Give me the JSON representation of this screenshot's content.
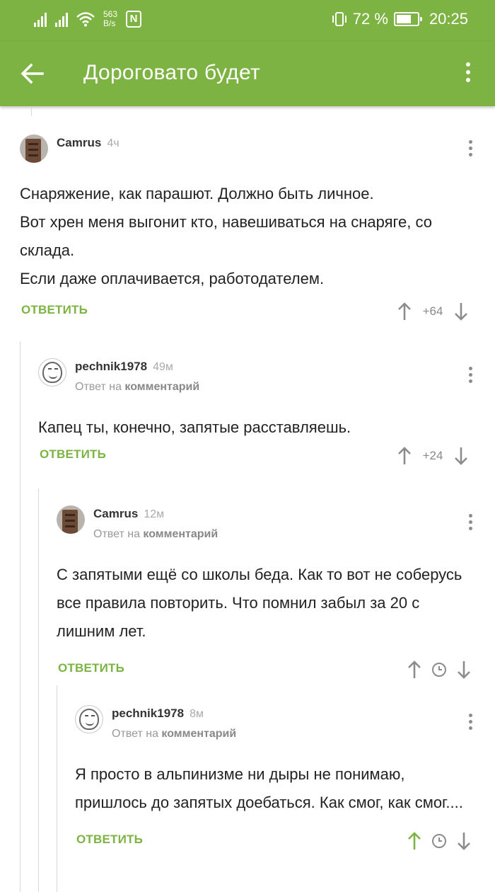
{
  "status_bar": {
    "speed_value": "563",
    "speed_unit": "B/s",
    "nfc_label": "N",
    "battery": "72 %",
    "battery_level": 0.72,
    "clock": "20:25"
  },
  "app_bar": {
    "title": "Дороговато будет",
    "back_icon": "arrow-left-icon",
    "menu_icon": "more-vertical-icon"
  },
  "colors": {
    "brand_green": "#7cb342",
    "upvote_active": "#7cb342",
    "muted": "#999999"
  },
  "comments": [
    {
      "author": "Camrus",
      "time": "4ч",
      "text": "Снаряжение, как парашют. Должно быть личное.\nВот хрен меня выгонит кто, навешиваться на снаряге, со склада.\nЕсли даже оплачивается, работодателем.",
      "reply_label": "ОТВЕТИТЬ",
      "rating": "+64"
    },
    {
      "author": "pechnik1978",
      "time": "49м",
      "reply_prefix": "Ответ на",
      "reply_target": "комментарий",
      "text": "Капец ты, конечно, запятые расставляешь.",
      "reply_label": "ОТВЕТИТЬ",
      "rating": "+24"
    },
    {
      "author": "Camrus",
      "time": "12м",
      "reply_prefix": "Ответ на",
      "reply_target": "комментарий",
      "text": "С запятыми ещё со школы беда. Как то вот не соберусь все правила повторить. Что помнил забыл за 20 с лишним лет.",
      "reply_label": "ОТВЕТИТЬ",
      "rating_icon": "clock-icon"
    },
    {
      "author": "pechnik1978",
      "time": "8м",
      "reply_prefix": "Ответ на",
      "reply_target": "комментарий",
      "text": "Я просто в альпинизме ни дыры не понимаю, пришлось до запятых доебаться. Как смог, как смог....",
      "reply_label": "ОТВЕТИТЬ",
      "rating_icon": "clock-icon",
      "upvoted": true
    }
  ]
}
